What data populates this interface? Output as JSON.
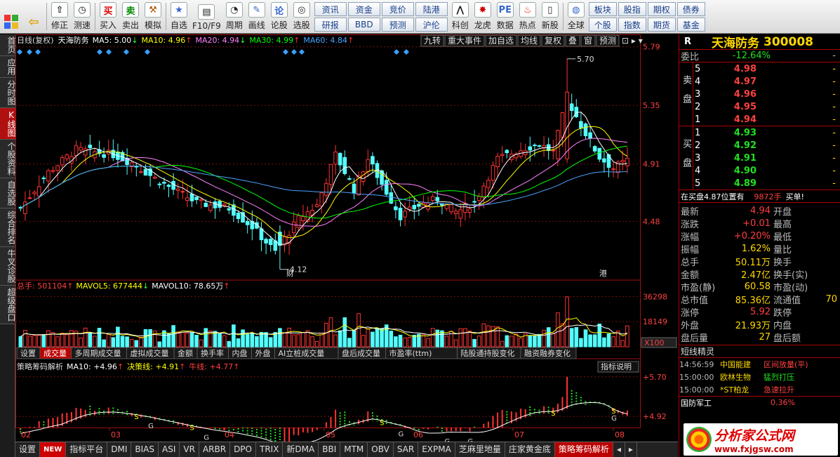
{
  "toolbar": {
    "left": [
      {
        "label": "",
        "icon": "windows-grid-icon"
      },
      {
        "label": "",
        "icon": "back-arrow-icon"
      },
      {
        "label": "修正",
        "icon": "fix-icon"
      },
      {
        "label": "测速",
        "icon": "clock-icon"
      },
      {
        "label": "买入",
        "icon": "buy-icon",
        "glyph": "买"
      },
      {
        "label": "卖出",
        "icon": "sell-icon",
        "glyph": "卖"
      },
      {
        "label": "模拟",
        "icon": "hammer-icon"
      },
      {
        "label": "自选",
        "icon": "star-icon"
      },
      {
        "label": "F10/F9",
        "icon": "f10-icon"
      },
      {
        "label": "周期",
        "icon": "period-icon"
      },
      {
        "label": "画线",
        "icon": "pen-icon"
      },
      {
        "label": "论股",
        "icon": "discuss-icon",
        "glyph": "论"
      },
      {
        "label": "选股",
        "icon": "select-stock-icon"
      }
    ],
    "grid1": [
      "资讯",
      "资金",
      "竞价",
      "陆港",
      "研报",
      "BBD",
      "预测",
      "沪伦"
    ],
    "right": [
      {
        "label": "科创",
        "icon": "kechuang-icon"
      },
      {
        "label": "龙虎",
        "icon": "dragon-tiger-icon"
      },
      {
        "label": "数据",
        "icon": "pe-data-icon",
        "glyph": "PE"
      },
      {
        "label": "热点",
        "icon": "hot-icon"
      },
      {
        "label": "新股",
        "icon": "new-stock-icon"
      },
      {
        "label": "全球",
        "icon": "globe-icon"
      }
    ],
    "grid2": [
      "板块",
      "股指",
      "期权",
      "债券",
      "个股",
      "指数",
      "期货",
      "基金"
    ]
  },
  "left_tabs": [
    "首页",
    "应用",
    "分时图",
    "K线图",
    "个股资料",
    "自选股",
    "综合排名",
    "牛叉诊股",
    "超级盘口"
  ],
  "left_tabs_active": 3,
  "header": {
    "period": "日线(复权)",
    "name": "天海防务",
    "ma5": "MA5: 5.00",
    "ma5_arrow": "↓",
    "ma10": "MA10: 4.96",
    "ma10_arrow": "↑",
    "ma20": "MA20: 4.94",
    "ma20_arrow": "↓",
    "ma30": "MA30: 4.99",
    "ma30_arrow": "↑",
    "ma60": "MA60: 4.84",
    "ma60_arrow": "↑"
  },
  "top_tools": [
    "九转",
    "重大事件",
    "加自选",
    "均线",
    "复权",
    "叠",
    "窗",
    "预测"
  ],
  "price_axis": [
    "5.79",
    "5.35",
    "4.91",
    "4.48"
  ],
  "price_marks": {
    "high": "5.70",
    "low": "4.12",
    "cai": "财",
    "gang": "港"
  },
  "vol_header": {
    "total": "总手: 501104",
    "total_arrow": "↑",
    "mavol5": "MAVOL5: 677444",
    "mavol5_arrow": "↓",
    "mavol10": "MAVOL10: 78.65万",
    "mavol10_arrow": "↑"
  },
  "vol_axis": [
    "36298",
    "18149",
    "X100"
  ],
  "vol_tabs": [
    "设置",
    "成交量",
    "多周期成交量",
    "虚拟成交量",
    "金额",
    "换手率",
    "内盘",
    "外盘",
    "AI立桩成交量",
    "盘后成交量",
    "市盈率(ttm)",
    "陆股通持股变化",
    "融资融券变化"
  ],
  "vol_tabs_active": 1,
  "ind_header": {
    "name": "策略筹码解析",
    "ma10": "MA10: +4.96",
    "ma10_arrow": "↑",
    "jc": "决策线: +4.91",
    "jc_arrow": "↑",
    "nx": "牛线: +4.77",
    "nx_arrow": "↑",
    "btn": "指标说明"
  },
  "ind_axis": [
    "+5.70",
    "+4.92"
  ],
  "date_axis": [
    "02",
    "03",
    "04",
    "05",
    "06",
    "07",
    "08"
  ],
  "bottom_tabs": [
    "设置",
    "NEW",
    "指标平台",
    "DMI",
    "BIAS",
    "ASI",
    "VR",
    "ARBR",
    "DPO",
    "TRIX",
    "新DMA",
    "BBI",
    "MTM",
    "OBV",
    "SAR",
    "EXPMA",
    "芝麻里地量",
    "庄家黄金底",
    "策略筹码解析"
  ],
  "bottom_tabs_active": 18,
  "quote": {
    "r": "R",
    "name": "天海防务",
    "code": "300008",
    "weibi_label": "委比",
    "weibi": "-12.64%",
    "weicha": "-",
    "sell_label": "卖盘",
    "buy_label": "买盘",
    "sells": [
      [
        "5",
        "4.98",
        "-"
      ],
      [
        "4",
        "4.97",
        "-"
      ],
      [
        "3",
        "4.96",
        "-"
      ],
      [
        "2",
        "4.95",
        "-"
      ],
      [
        "1",
        "4.94",
        "-"
      ]
    ],
    "buys": [
      [
        "1",
        "4.93",
        "-"
      ],
      [
        "2",
        "4.92",
        "-"
      ],
      [
        "3",
        "4.91",
        "-"
      ],
      [
        "4",
        "4.90",
        "-"
      ],
      [
        "5",
        "4.89",
        "-"
      ]
    ],
    "zaimai": "在买盘4.87位置有",
    "zaimai_vol": "9872手",
    "zaimai_tag": "买单!",
    "stats": [
      [
        "最新",
        "4.94",
        "开盘",
        ""
      ],
      [
        "涨跌",
        "+0.01",
        "最高",
        ""
      ],
      [
        "涨幅",
        "+0.20%",
        "最低",
        ""
      ],
      [
        "振幅",
        "1.62%",
        "量比",
        ""
      ],
      [
        "总手",
        "50.11万",
        "换手",
        ""
      ],
      [
        "金额",
        "2.47亿",
        "换手(实)",
        ""
      ],
      [
        "市盈(静)",
        "60.58",
        "市盈(动)",
        ""
      ],
      [
        "总市值",
        "85.36亿",
        "流通值",
        "70"
      ],
      [
        "涨停",
        "5.92",
        "跌停",
        ""
      ],
      [
        "外盘",
        "21.93万",
        "内盘",
        ""
      ],
      [
        "盘后量",
        "27",
        "盘后额",
        ""
      ]
    ],
    "sprite_title": "短线精灵",
    "sprite": [
      [
        "14:56:59",
        "中国能建",
        "区间放量(平)"
      ],
      [
        "15:00:00",
        "欧林生物",
        "猛烈打压"
      ],
      [
        "15:00:00",
        "*ST柏龙",
        "急速拉升"
      ]
    ],
    "bottom_name": "国防军工",
    "bottom_pct": "0.36%",
    "watermark": "分析家公式网",
    "watermark_url": "www.fxjgsw.com"
  },
  "colors": {
    "up": "#ff3232",
    "down": "#54ffff",
    "ma5": "#ffffff",
    "ma10": "#ffff00",
    "ma20": "#ff80ff",
    "ma30": "#00ff00",
    "ma60": "#4aa3ff"
  }
}
